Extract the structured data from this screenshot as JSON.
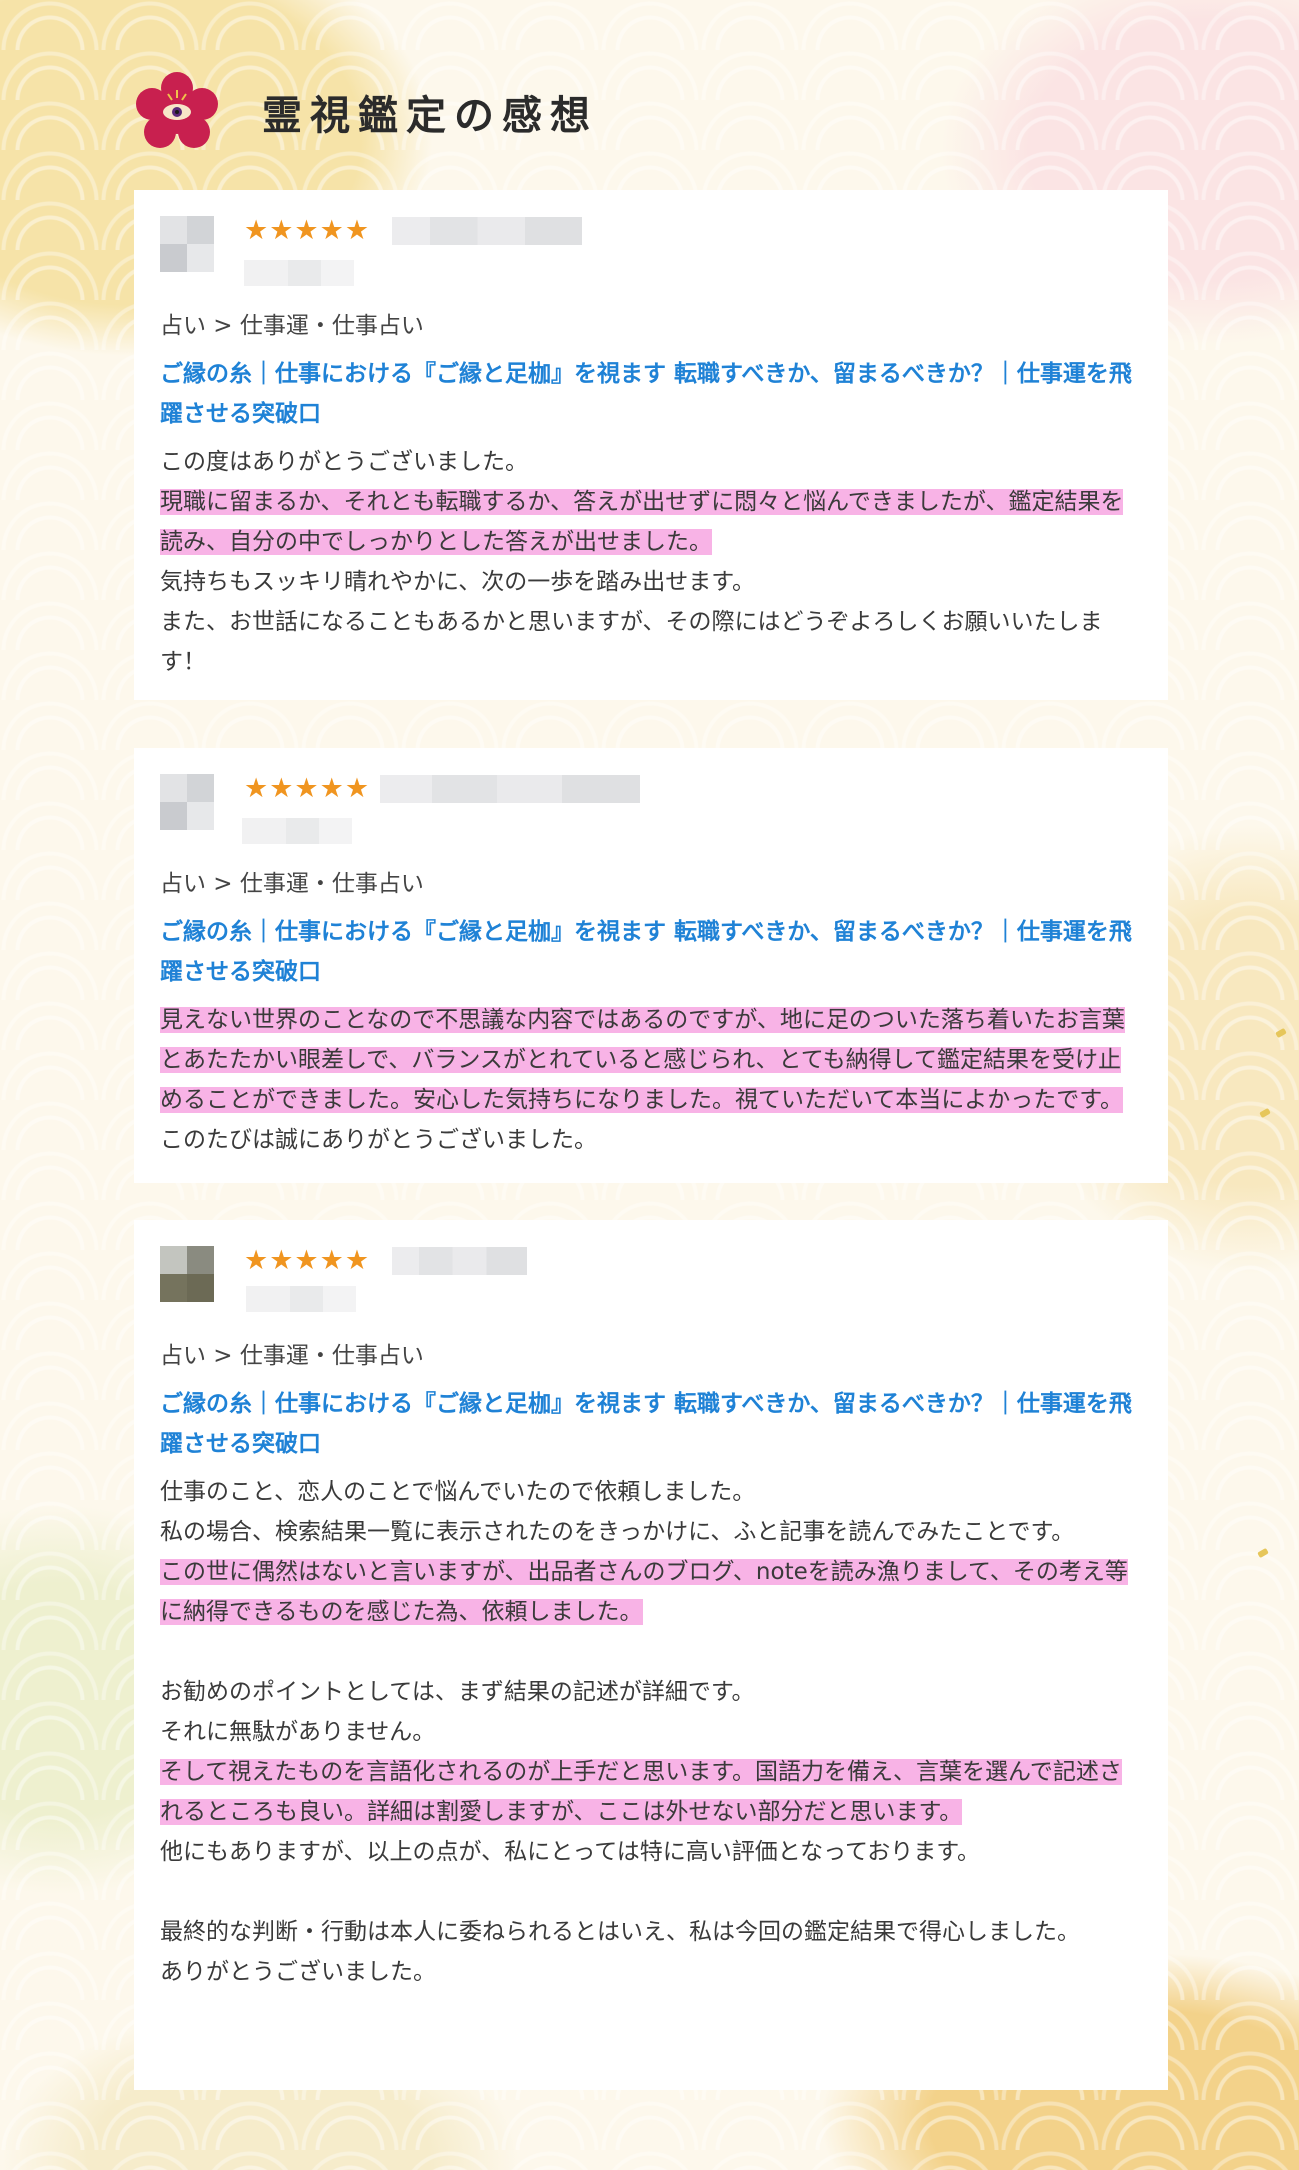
{
  "header": {
    "title": "霊視鑑定の感想",
    "emblem_icon": "plum-blossom-eye-icon"
  },
  "colors": {
    "accent_link": "#1f82d6",
    "highlight": "#f8b3e6",
    "star": "#f09520",
    "emblem": "#c8204f"
  },
  "reviews": [
    {
      "rating": 5,
      "stars": "★★★★★",
      "breadcrumb": "占い > 仕事運・仕事占い",
      "service_title": "ご縁の糸｜仕事における『ご縁と足枷』を視ます 転職すべきか、留まるべきか？｜仕事運を飛躍させる突破口",
      "lines": [
        {
          "t": "この度はありがとうございました。",
          "hl": false
        },
        {
          "t": "現職に留まるか、それとも転職するか、答えが出せずに悶々と悩んできましたが、鑑定結果を読み、自分の中でしっかりとした答えが出せました。",
          "hl": true
        },
        {
          "t": "気持ちもスッキリ晴れやかに、次の一歩を踏み出せます。",
          "hl": false
        },
        {
          "t": "また、お世話になることもあるかと思いますが、その際にはどうぞよろしくお願いいたします！",
          "hl": false
        }
      ]
    },
    {
      "rating": 5,
      "stars": "★★★★★",
      "breadcrumb": "占い > 仕事運・仕事占い",
      "service_title": "ご縁の糸｜仕事における『ご縁と足枷』を視ます 転職すべきか、留まるべきか？｜仕事運を飛躍させる突破口",
      "lines": [
        {
          "t": "見えない世界のことなので不思議な内容ではあるのですが、地に足のついた落ち着いたお言葉とあたたかい眼差しで、バランスがとれていると感じられ、とても納得して鑑定結果を受け止めることができました。安心した気持ちになりました。視ていただいて本当によかったです。",
          "hl": true,
          "tail": "このたびは誠にありがとうございました。"
        }
      ]
    },
    {
      "rating": 5,
      "stars": "★★★★★",
      "breadcrumb": "占い > 仕事運・仕事占い",
      "service_title": "ご縁の糸｜仕事における『ご縁と足枷』を視ます 転職すべきか、留まるべきか？｜仕事運を飛躍させる突破口",
      "lines": [
        {
          "t": "仕事のこと、恋人のことで悩んでいたので依頼しました。",
          "hl": false
        },
        {
          "t": "私の場合、検索結果一覧に表示されたのをきっかけに、ふと記事を読んでみたことです。",
          "hl": false
        },
        {
          "t": "この世に偶然はないと言いますが、出品者さんのブログ、noteを読み漁りまして、その考え等に納得できるものを感じた為、依頼しました。",
          "hl": true
        },
        {
          "t": "",
          "hl": false
        },
        {
          "t": "お勧めのポイントとしては、まず結果の記述が詳細です。",
          "hl": false
        },
        {
          "t": "それに無駄がありません。",
          "hl": false
        },
        {
          "t": "そして視えたものを言語化されるのが上手だと思います。国語力を備え、言葉を選んで記述されるところも良い。詳細は割愛しますが、ここは外せない部分だと思います。",
          "hl": true
        },
        {
          "t": "他にもありますが、以上の点が、私にとっては特に高い評価となっております。",
          "hl": false
        },
        {
          "t": "",
          "hl": false
        },
        {
          "t": "最終的な判断・行動は本人に委ねられるとはいえ、私は今回の鑑定結果で得心しました。",
          "hl": false
        },
        {
          "t": "ありがとうございました。",
          "hl": false
        }
      ]
    }
  ]
}
